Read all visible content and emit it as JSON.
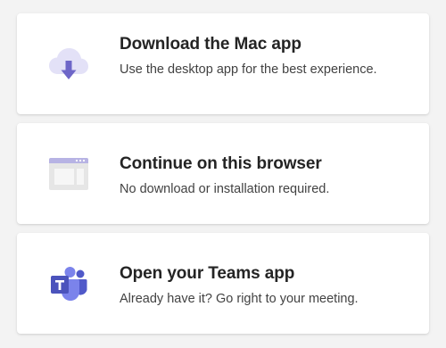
{
  "options": [
    {
      "title": "Download the Mac app",
      "subtitle": "Use the desktop app for the best experience.",
      "icon": "cloud-download-icon"
    },
    {
      "title": "Continue on this browser",
      "subtitle": "No download or installation required.",
      "icon": "browser-window-icon"
    },
    {
      "title": "Open your Teams app",
      "subtitle": "Already have it? Go right to your meeting.",
      "icon": "teams-logo-icon"
    }
  ],
  "colors": {
    "page_background": "#f3f3f3",
    "card_background": "#ffffff",
    "teams_purple": "#5b5fc7",
    "teams_purple_light": "#7b83eb",
    "cloud_light": "#e3e1f7",
    "arrow_purple": "#6e66c8",
    "browser_gray": "#e6e6e6",
    "browser_bar": "#b7b3e4"
  }
}
